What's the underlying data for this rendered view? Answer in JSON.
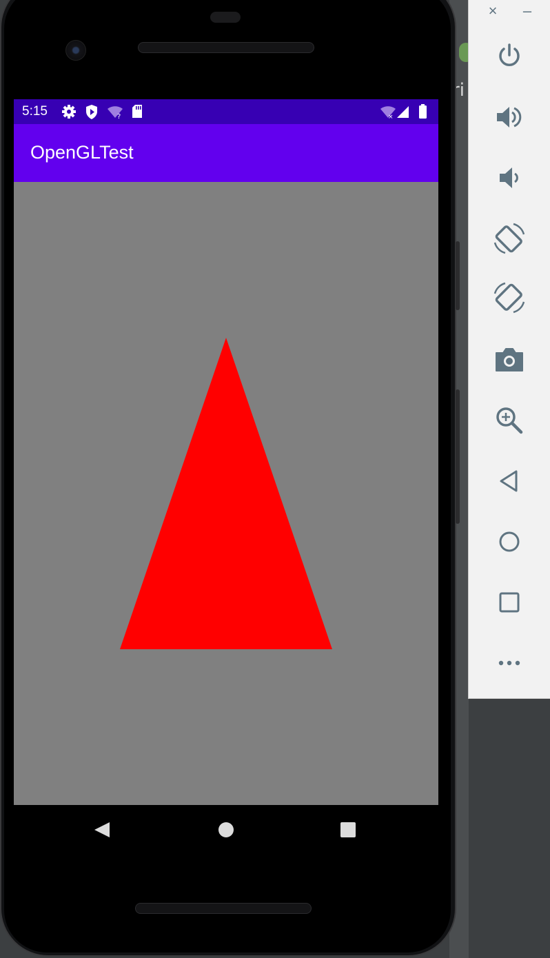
{
  "status_bar": {
    "time": "5:15"
  },
  "app_bar": {
    "title": "OpenGLTest"
  },
  "background_editor": {
    "partial_text": "ri"
  },
  "colors": {
    "status_bar": "#3700b3",
    "app_bar": "#6200ee",
    "gl_clear": "#808080",
    "triangle": "#ff0000",
    "toolbar_icon": "#5f7481"
  },
  "status_icons_left": [
    "settings-icon",
    "shield-icon",
    "wifi-question-icon",
    "sd-card-icon"
  ],
  "status_icons_right": [
    "wifi-off-icon",
    "cell-signal-icon",
    "battery-icon"
  ],
  "nav_bar": [
    "back-icon",
    "home-icon",
    "recents-icon"
  ],
  "emulator_toolbar": {
    "window_controls": [
      {
        "name": "close",
        "label": "×"
      },
      {
        "name": "minimize",
        "label": "–"
      }
    ],
    "buttons": [
      "power",
      "volume-up",
      "volume-down",
      "rotate-left",
      "rotate-right",
      "screenshot",
      "zoom",
      "back",
      "home",
      "overview",
      "more"
    ]
  }
}
